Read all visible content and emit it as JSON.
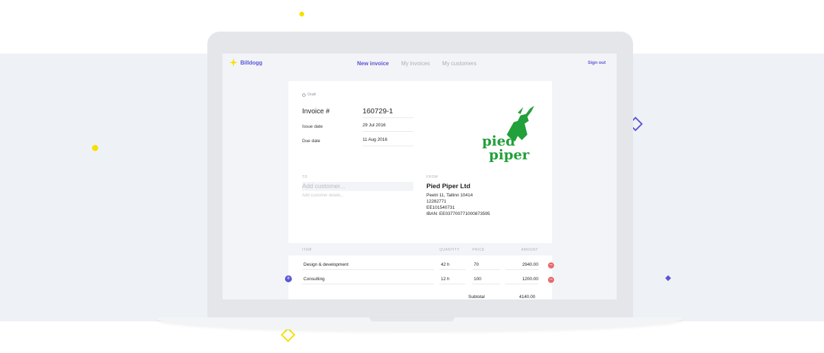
{
  "app": {
    "name": "Billdogg",
    "brand_color": "#5a55d6",
    "accent_color": "#f5e000"
  },
  "nav": {
    "items": [
      {
        "label": "New invoice",
        "active": true
      },
      {
        "label": "My invoices",
        "active": false
      },
      {
        "label": "My customers",
        "active": false
      }
    ],
    "sign_out": "Sign out"
  },
  "invoice": {
    "status": "Draft",
    "number_label": "Invoice #",
    "number": "160729-1",
    "issue_date_label": "Issue date",
    "issue_date": "29 Jul 2016",
    "due_date_label": "Due date",
    "due_date": "11 Aug 2016",
    "logo_text_1": "pied",
    "logo_text_2": "piper",
    "to": {
      "label": "TO",
      "customer_placeholder": "Add customer...",
      "details_placeholder": "Add customer details..."
    },
    "from": {
      "label": "FROM",
      "name": "Pied Piper Ltd",
      "address": "Peetri 11, Tallinn 10414",
      "reg_code": "12282771",
      "vat": "EE101540731",
      "iban": "IBAN: EE037700771000873595"
    },
    "items_header": {
      "item": "ITEM",
      "quantity": "QUANTITY",
      "price": "PRICE",
      "amount": "AMOUNT"
    },
    "items": [
      {
        "name": "Design & development",
        "quantity": "42 h",
        "price": "70",
        "amount": "2940.00"
      },
      {
        "name": "Consulting",
        "quantity": "12 h",
        "price": "100",
        "amount": "1200.00"
      }
    ],
    "subtotal_label": "Subtotal",
    "subtotal": "4140.00"
  }
}
